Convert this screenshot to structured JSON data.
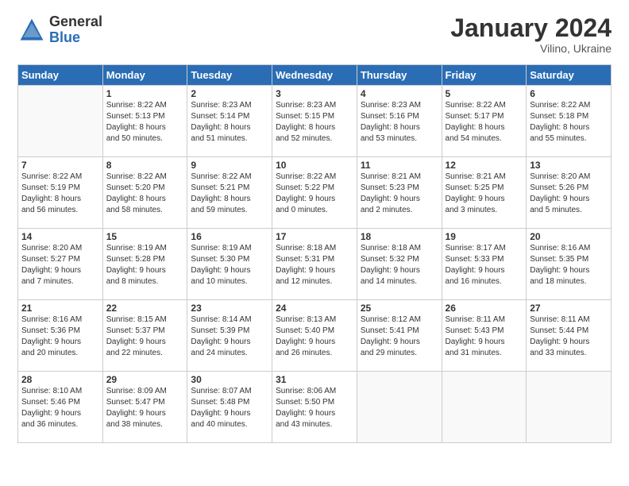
{
  "logo": {
    "general": "General",
    "blue": "Blue"
  },
  "title": "January 2024",
  "subtitle": "Vilino, Ukraine",
  "headers": [
    "Sunday",
    "Monday",
    "Tuesday",
    "Wednesday",
    "Thursday",
    "Friday",
    "Saturday"
  ],
  "weeks": [
    [
      {
        "day": "",
        "info": ""
      },
      {
        "day": "1",
        "info": "Sunrise: 8:22 AM\nSunset: 5:13 PM\nDaylight: 8 hours\nand 50 minutes."
      },
      {
        "day": "2",
        "info": "Sunrise: 8:23 AM\nSunset: 5:14 PM\nDaylight: 8 hours\nand 51 minutes."
      },
      {
        "day": "3",
        "info": "Sunrise: 8:23 AM\nSunset: 5:15 PM\nDaylight: 8 hours\nand 52 minutes."
      },
      {
        "day": "4",
        "info": "Sunrise: 8:23 AM\nSunset: 5:16 PM\nDaylight: 8 hours\nand 53 minutes."
      },
      {
        "day": "5",
        "info": "Sunrise: 8:22 AM\nSunset: 5:17 PM\nDaylight: 8 hours\nand 54 minutes."
      },
      {
        "day": "6",
        "info": "Sunrise: 8:22 AM\nSunset: 5:18 PM\nDaylight: 8 hours\nand 55 minutes."
      }
    ],
    [
      {
        "day": "7",
        "info": "Sunrise: 8:22 AM\nSunset: 5:19 PM\nDaylight: 8 hours\nand 56 minutes."
      },
      {
        "day": "8",
        "info": "Sunrise: 8:22 AM\nSunset: 5:20 PM\nDaylight: 8 hours\nand 58 minutes."
      },
      {
        "day": "9",
        "info": "Sunrise: 8:22 AM\nSunset: 5:21 PM\nDaylight: 8 hours\nand 59 minutes."
      },
      {
        "day": "10",
        "info": "Sunrise: 8:22 AM\nSunset: 5:22 PM\nDaylight: 9 hours\nand 0 minutes."
      },
      {
        "day": "11",
        "info": "Sunrise: 8:21 AM\nSunset: 5:23 PM\nDaylight: 9 hours\nand 2 minutes."
      },
      {
        "day": "12",
        "info": "Sunrise: 8:21 AM\nSunset: 5:25 PM\nDaylight: 9 hours\nand 3 minutes."
      },
      {
        "day": "13",
        "info": "Sunrise: 8:20 AM\nSunset: 5:26 PM\nDaylight: 9 hours\nand 5 minutes."
      }
    ],
    [
      {
        "day": "14",
        "info": "Sunrise: 8:20 AM\nSunset: 5:27 PM\nDaylight: 9 hours\nand 7 minutes."
      },
      {
        "day": "15",
        "info": "Sunrise: 8:19 AM\nSunset: 5:28 PM\nDaylight: 9 hours\nand 8 minutes."
      },
      {
        "day": "16",
        "info": "Sunrise: 8:19 AM\nSunset: 5:30 PM\nDaylight: 9 hours\nand 10 minutes."
      },
      {
        "day": "17",
        "info": "Sunrise: 8:18 AM\nSunset: 5:31 PM\nDaylight: 9 hours\nand 12 minutes."
      },
      {
        "day": "18",
        "info": "Sunrise: 8:18 AM\nSunset: 5:32 PM\nDaylight: 9 hours\nand 14 minutes."
      },
      {
        "day": "19",
        "info": "Sunrise: 8:17 AM\nSunset: 5:33 PM\nDaylight: 9 hours\nand 16 minutes."
      },
      {
        "day": "20",
        "info": "Sunrise: 8:16 AM\nSunset: 5:35 PM\nDaylight: 9 hours\nand 18 minutes."
      }
    ],
    [
      {
        "day": "21",
        "info": "Sunrise: 8:16 AM\nSunset: 5:36 PM\nDaylight: 9 hours\nand 20 minutes."
      },
      {
        "day": "22",
        "info": "Sunrise: 8:15 AM\nSunset: 5:37 PM\nDaylight: 9 hours\nand 22 minutes."
      },
      {
        "day": "23",
        "info": "Sunrise: 8:14 AM\nSunset: 5:39 PM\nDaylight: 9 hours\nand 24 minutes."
      },
      {
        "day": "24",
        "info": "Sunrise: 8:13 AM\nSunset: 5:40 PM\nDaylight: 9 hours\nand 26 minutes."
      },
      {
        "day": "25",
        "info": "Sunrise: 8:12 AM\nSunset: 5:41 PM\nDaylight: 9 hours\nand 29 minutes."
      },
      {
        "day": "26",
        "info": "Sunrise: 8:11 AM\nSunset: 5:43 PM\nDaylight: 9 hours\nand 31 minutes."
      },
      {
        "day": "27",
        "info": "Sunrise: 8:11 AM\nSunset: 5:44 PM\nDaylight: 9 hours\nand 33 minutes."
      }
    ],
    [
      {
        "day": "28",
        "info": "Sunrise: 8:10 AM\nSunset: 5:46 PM\nDaylight: 9 hours\nand 36 minutes."
      },
      {
        "day": "29",
        "info": "Sunrise: 8:09 AM\nSunset: 5:47 PM\nDaylight: 9 hours\nand 38 minutes."
      },
      {
        "day": "30",
        "info": "Sunrise: 8:07 AM\nSunset: 5:48 PM\nDaylight: 9 hours\nand 40 minutes."
      },
      {
        "day": "31",
        "info": "Sunrise: 8:06 AM\nSunset: 5:50 PM\nDaylight: 9 hours\nand 43 minutes."
      },
      {
        "day": "",
        "info": ""
      },
      {
        "day": "",
        "info": ""
      },
      {
        "day": "",
        "info": ""
      }
    ]
  ]
}
